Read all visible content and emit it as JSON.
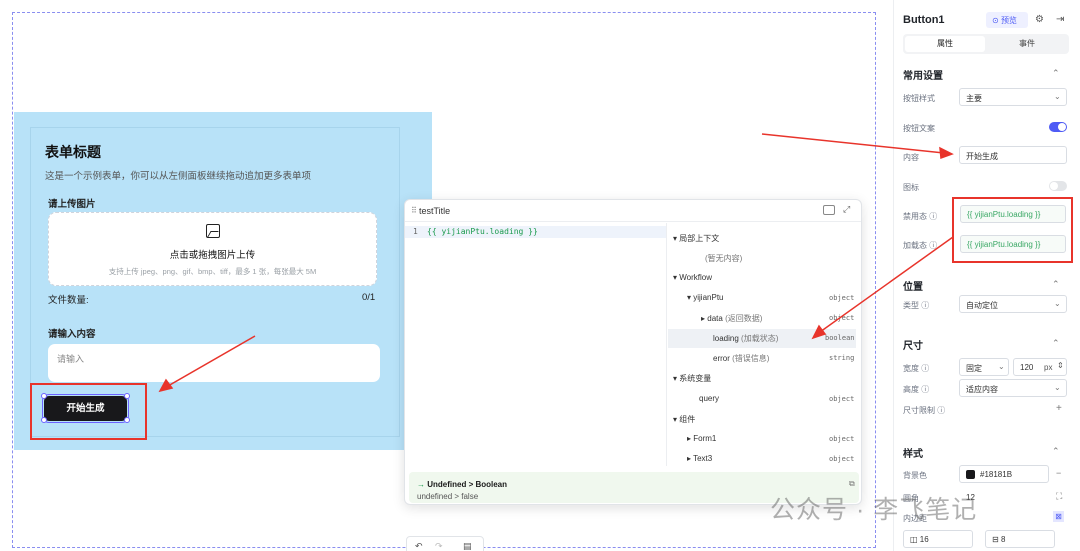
{
  "form": {
    "title": "表单标题",
    "desc": "这是一个示例表单，你可以从左侧面板继续拖动追加更多表单项",
    "upload_label": "请上传图片",
    "upload_text": "点击或拖拽图片上传",
    "upload_hint": "支持上传 jpeg、png、gif、bmp、tiff，最多 1 张，每张最大 5M",
    "count_label": "文件数量:",
    "count_value": "0/1",
    "input_label": "请输入内容",
    "input_placeholder": "请输入",
    "run_button": "开始生成"
  },
  "popup": {
    "title": "testTitle",
    "line_no": "1",
    "code": "{{ yijianPtu.loading }}",
    "tree": [
      {
        "label": "局部上下文",
        "type": ""
      },
      {
        "label": "(暂无内容)",
        "type": ""
      },
      {
        "label": "Workflow",
        "type": ""
      },
      {
        "label": "yijianPtu",
        "type": "object"
      },
      {
        "label": "data",
        "note": "(返回数据)",
        "type": "object"
      },
      {
        "label": "loading",
        "note": "(加载状态)",
        "type": "boolean"
      },
      {
        "label": "error",
        "note": "(错误信息)",
        "type": "string"
      },
      {
        "label": "系统变量",
        "type": ""
      },
      {
        "label": "query",
        "type": "object"
      },
      {
        "label": "组件",
        "type": ""
      },
      {
        "label": "Form1",
        "type": "object"
      },
      {
        "label": "Text3",
        "type": "object"
      }
    ],
    "result_type": "Undefined > Boolean",
    "result_value": "undefined > false"
  },
  "panel": {
    "component": "Button1",
    "preview": "预览",
    "tabs": [
      "属性",
      "事件"
    ],
    "sec_common": "常用设置",
    "btn_style_label": "按钮样式",
    "btn_style_value": "主要",
    "btn_text_label": "按钮文案",
    "content_label": "内容",
    "content_value": "开始生成",
    "icon_label": "图标",
    "disabled_label": "禁用态",
    "disabled_value": "{{ yijianPtu.loading }}",
    "loading_label": "加载态",
    "loading_value": "{{ yijianPtu.loading }}",
    "sec_position": "位置",
    "type_label": "类型",
    "type_value": "自动定位",
    "sec_size": "尺寸",
    "width_label": "宽度",
    "width_mode": "固定",
    "width_value": "120",
    "width_unit": "px",
    "height_label": "高度",
    "height_value": "适应内容",
    "limit_label": "尺寸限制",
    "sec_style": "样式",
    "bg_label": "背景色",
    "bg_value": "#18181B",
    "radius_label": "圆角",
    "radius_value": "12",
    "padding_label": "内边距",
    "pad_a": "16",
    "pad_b": "8"
  },
  "watermark": "公众号 · 李飞笔记",
  "colors": {
    "accent": "#4e5bf5",
    "button": "#18181B",
    "highlight_red": "#e8342b"
  }
}
